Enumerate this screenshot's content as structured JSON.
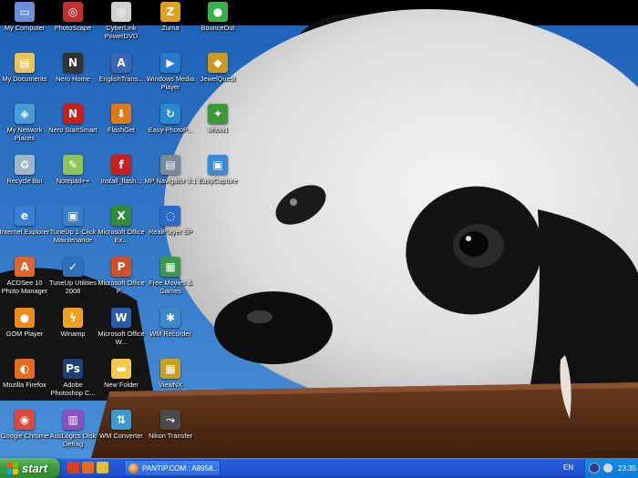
{
  "desktop_icons": [
    {
      "label": "My Computer",
      "icon": "computer-icon",
      "color": "#6a8fd8",
      "glyph": "▭"
    },
    {
      "label": "My Documents",
      "icon": "documents-folder-icon",
      "color": "#e8c35a",
      "glyph": "▤"
    },
    {
      "label": "My Network Places",
      "icon": "network-icon",
      "color": "#4a9ad6",
      "glyph": "◈"
    },
    {
      "label": "Recycle Bin",
      "icon": "recycle-bin-icon",
      "color": "#9fb6c9",
      "glyph": "♻"
    },
    {
      "label": "Internet Explorer",
      "icon": "internet-explorer-icon",
      "color": "#3a7fd5",
      "glyph": "e"
    },
    {
      "label": "ACDSee 10 Photo Manager",
      "icon": "acdsee-icon",
      "color": "#e0652a",
      "glyph": "A"
    },
    {
      "label": "GOM Player",
      "icon": "gom-player-icon",
      "color": "#f08a18",
      "glyph": "●"
    },
    {
      "label": "Mozilla Firefox",
      "icon": "firefox-icon",
      "color": "#e66a1c",
      "glyph": "◐"
    },
    {
      "label": "Google Chrome",
      "icon": "chrome-icon",
      "color": "#d84a3a",
      "glyph": "◉"
    },
    {
      "label": "PhotoScape",
      "icon": "photoscape-icon",
      "color": "#c23030",
      "glyph": "◎"
    },
    {
      "label": "Nero Home",
      "icon": "nero-home-icon",
      "color": "#333333",
      "glyph": "N"
    },
    {
      "label": "Nero StartSmart",
      "icon": "nero-startsmart-icon",
      "color": "#c81e1e",
      "glyph": "N"
    },
    {
      "label": "Notepad++",
      "icon": "notepadpp-icon",
      "color": "#8fc45a",
      "glyph": "✎"
    },
    {
      "label": "TuneUp 1-Click Maintenance",
      "icon": "tuneup-icon",
      "color": "#3a7ec8",
      "glyph": "▣"
    },
    {
      "label": "TuneUp Utilities 2008",
      "icon": "tuneup-utilities-icon",
      "color": "#2f6fba",
      "glyph": "✓"
    },
    {
      "label": "Winamp",
      "icon": "winamp-icon",
      "color": "#f0a020",
      "glyph": "ϟ"
    },
    {
      "label": "Adobe Photoshop C...",
      "icon": "photoshop-icon",
      "color": "#1e3f78",
      "glyph": "Ps"
    },
    {
      "label": "AusLogics Disk Defrag",
      "icon": "auslogics-icon",
      "color": "#8a4fc0",
      "glyph": "▥"
    },
    {
      "label": "CyberLink PowerDVD",
      "icon": "powerdvd-icon",
      "color": "#d0d0d0",
      "glyph": "◎"
    },
    {
      "label": "EnglishTrans...",
      "icon": "englishtrans-icon",
      "color": "#3c66b8",
      "glyph": "A"
    },
    {
      "label": "FlashGet",
      "icon": "flashget-icon",
      "color": "#e07a18",
      "glyph": "⬇"
    },
    {
      "label": "install_flash...",
      "icon": "flash-installer-icon",
      "color": "#c82020",
      "glyph": "f"
    },
    {
      "label": "Microsoft Office Ex...",
      "icon": "excel-icon",
      "color": "#2f8a3a",
      "glyph": "X"
    },
    {
      "label": "Microsoft Office P...",
      "icon": "powerpoint-icon",
      "color": "#d0502a",
      "glyph": "P"
    },
    {
      "label": "Microsoft Office W...",
      "icon": "word-icon",
      "color": "#2a5aad",
      "glyph": "W"
    },
    {
      "label": "New Folder",
      "icon": "folder-icon",
      "color": "#f2c94c",
      "glyph": "▬"
    },
    {
      "label": "WM Converter",
      "icon": "wm-converter-icon",
      "color": "#3a9ad0",
      "glyph": "⇅"
    },
    {
      "label": "Zuma",
      "icon": "zuma-icon",
      "color": "#e0a020",
      "glyph": "Z"
    },
    {
      "label": "Windows Media Player",
      "icon": "wmp-icon",
      "color": "#2a7ad0",
      "glyph": "▶"
    },
    {
      "label": "Easy-PhotoP...",
      "icon": "easy-photo-icon",
      "color": "#2a8ad0",
      "glyph": "↻"
    },
    {
      "label": "MP Navigator 3.1",
      "icon": "mp-navigator-icon",
      "color": "#7a8a9a",
      "glyph": "▤"
    },
    {
      "label": "RealPlayer SP",
      "icon": "realplayer-icon",
      "color": "#2a6ac8",
      "glyph": "◌"
    },
    {
      "label": "Free Movies & Games",
      "icon": "free-movies-icon",
      "color": "#3a9a4a",
      "glyph": "▦"
    },
    {
      "label": "WM Recorder",
      "icon": "wm-recorder-icon",
      "color": "#3a8ac8",
      "glyph": "✱"
    },
    {
      "label": "ViewNX",
      "icon": "viewnx-icon",
      "color": "#c8a020",
      "glyph": "▦"
    },
    {
      "label": "Nikon Transfer",
      "icon": "nikon-transfer-icon",
      "color": "#4a4a4a",
      "glyph": "⤳"
    },
    {
      "label": "BounceOut",
      "icon": "bounceout-icon",
      "color": "#3ab04a",
      "glyph": "●"
    },
    {
      "label": "JewelQuest",
      "icon": "jewelquest-icon",
      "color": "#c89a20",
      "glyph": "◆"
    },
    {
      "label": "whow1",
      "icon": "whow-icon",
      "color": "#3a9a3a",
      "glyph": "✦"
    },
    {
      "label": "EasyCapture",
      "icon": "easycapture-icon",
      "color": "#3a8ad8",
      "glyph": "▣"
    }
  ],
  "taskbar": {
    "start_label": "start",
    "quick_launch": [
      {
        "icon": "quicklaunch-acrobat-icon",
        "color": "#d84020"
      },
      {
        "icon": "quicklaunch-firefox-icon",
        "color": "#e86a1c"
      },
      {
        "icon": "quicklaunch-chrome-icon",
        "color": "#e0c030"
      }
    ],
    "active_window": "PANTIP.COM : A8958...",
    "language": "EN",
    "clock": "23:35"
  }
}
